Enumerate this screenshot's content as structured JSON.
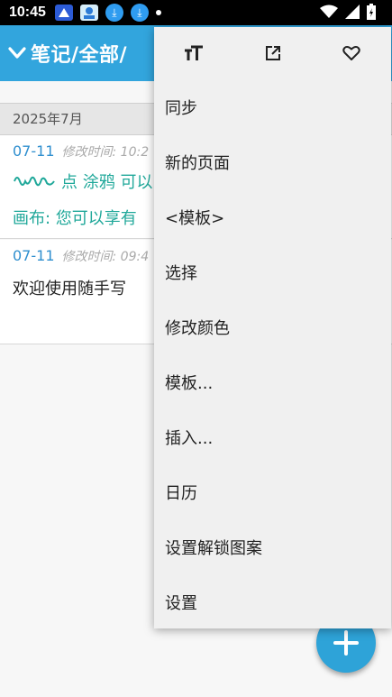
{
  "status": {
    "time": "10:45",
    "left_icons": [
      "bird-app-icon",
      "avatar-app-icon",
      "download-icon",
      "download-icon",
      "dot-icon"
    ],
    "right_icons": [
      "wifi-icon",
      "signal-icon",
      "battery-icon"
    ]
  },
  "appbar": {
    "title": "笔记/全部/"
  },
  "list": {
    "month": "2025年7月",
    "notes": [
      {
        "date": "07-11",
        "modified": "修改时间: 10:2",
        "line1": "点 涂鸦 可以",
        "line2": "画布: 您可以享有"
      },
      {
        "date": "07-11",
        "modified": "修改时间: 09:4",
        "line1": "欢迎使用随手写"
      }
    ]
  },
  "menu": {
    "toolbar": [
      "text-size-icon",
      "open-external-icon",
      "heart-icon"
    ],
    "items": [
      "同步",
      "新的页面",
      "<模板>",
      "选择",
      "修改颜色",
      "模板...",
      "插入...",
      "日历",
      "设置解锁图案",
      "设置"
    ]
  },
  "colors": {
    "accent": "#32a5dd",
    "teal": "#20a89a",
    "date_blue": "#2f8fcf"
  }
}
